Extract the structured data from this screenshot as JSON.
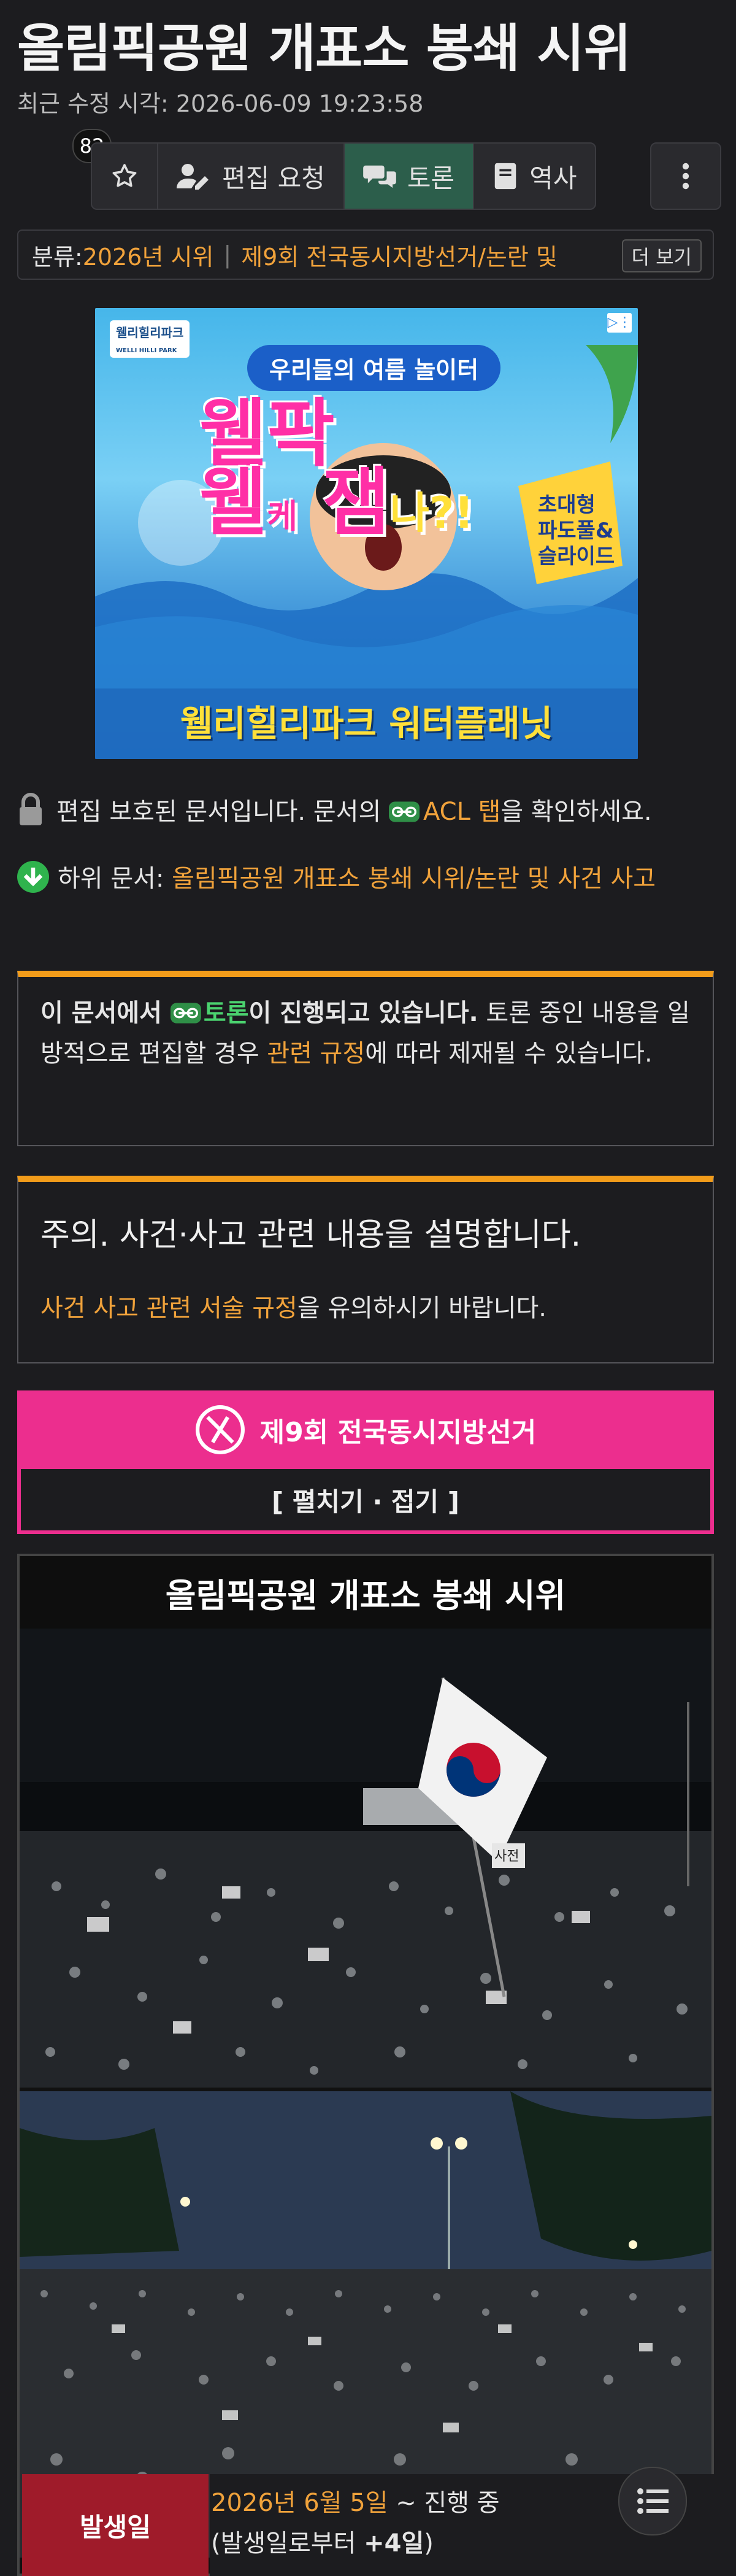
{
  "page": {
    "title": "올림픽공원 개표소 봉쇄 시위",
    "modified_label": "최근 수정 시각: ",
    "modified_time": "2026-06-09 19:23:58",
    "star_count": "82"
  },
  "toolbar": {
    "edit_request": "편집 요청",
    "discussion": "토론",
    "history": "역사"
  },
  "category": {
    "label": "분류:",
    "items": [
      "2026년 시위",
      "제9회 전국동시지방선거/논란 및"
    ],
    "more": "더 보기"
  },
  "ad": {
    "brand": "웰리힐리파크",
    "brand_sub": "WELLI HILLI PARK",
    "banner_top": "우리들의 여름 놀이터",
    "headline_1": "웰팍",
    "headline_2": "웰",
    "headline_3": "케",
    "headline_4": "잼",
    "headline_5": "나?!",
    "side_text": "초대형\n파도풀&\n슬라이드",
    "bottom_text": "웰리힐리파크 워터플래닛"
  },
  "protect": {
    "text_before": "편집 보호된 문서입니다. 문서의 ",
    "acl_link": "ACL 탭",
    "text_after": "을 확인하세요."
  },
  "subdoc": {
    "label": "하위 문서: ",
    "link": "올림픽공원 개표소 봉쇄 시위/논란 및 사건 사고"
  },
  "notice_discussion": {
    "bold_prefix": "이 문서에서 ",
    "link": "토론",
    "bold_suffix": "이 진행되고 있습니다.",
    "text1": " 토론 중인 내용을 일방적으로 편집할 경우 ",
    "rule_link": "관련 규정",
    "text2": "에 따라 제재될 수 있습니다."
  },
  "notice_incident": {
    "heading": "주의. 사건·사고 관련 내용을 설명합니다.",
    "rule_link": "사건 사고 관련 서술 규정",
    "text": "을 유의하시기 바랍니다."
  },
  "election": {
    "title": "제9회 전국동시지방선거",
    "toggle": "[ 펼치기 · 접기 ]"
  },
  "infobox": {
    "title": "올림픽공원 개표소 봉쇄 시위",
    "sign_text": "사전",
    "row_label": "발생일",
    "date_link": "2026년 6월 5일",
    "date_suffix": " ~ 진행 중",
    "since_prefix": "(발생일로부터 ",
    "since_bold": "+4일",
    "since_suffix": ")"
  },
  "colors": {
    "accent_orange": "#f0a23b",
    "discussion_green": "#2c5e4b",
    "election_pink": "#ec2e8e",
    "row_label_red": "#9f1b2a"
  }
}
